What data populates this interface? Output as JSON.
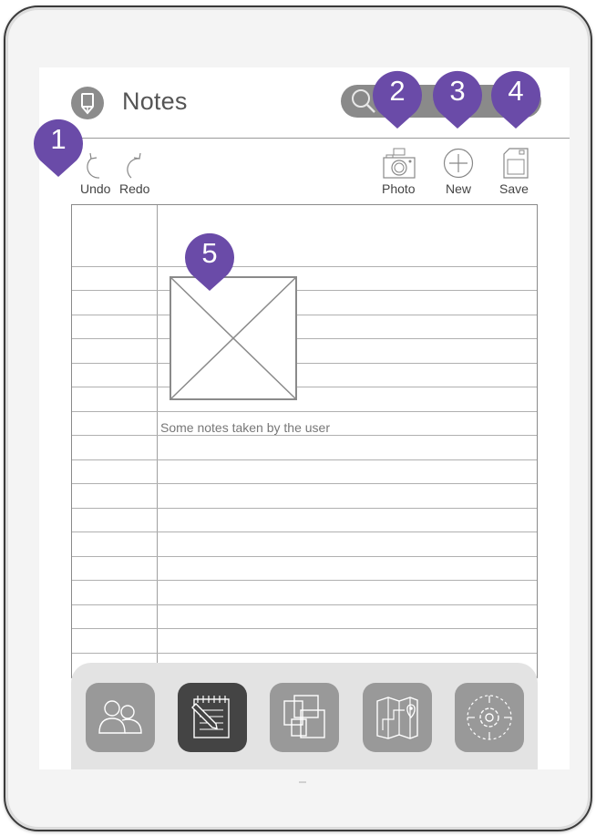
{
  "app": {
    "title": "Notes"
  },
  "toolbar": {
    "undo_label": "Undo",
    "redo_label": "Redo",
    "photo_label": "Photo",
    "new_label": "New",
    "save_label": "Save"
  },
  "note": {
    "text": "Some notes taken by the user"
  },
  "dock": {
    "items": [
      {
        "icon": "contacts-icon",
        "active": false
      },
      {
        "icon": "notepad-icon",
        "active": true
      },
      {
        "icon": "gallery-icon",
        "active": false
      },
      {
        "icon": "map-icon",
        "active": false
      },
      {
        "icon": "settings-icon",
        "active": false
      }
    ]
  },
  "markers": [
    "1",
    "2",
    "3",
    "4",
    "5"
  ],
  "colors": {
    "marker": "#6a4ba8",
    "dock_active": "#444444",
    "dock_inactive": "#999999"
  }
}
